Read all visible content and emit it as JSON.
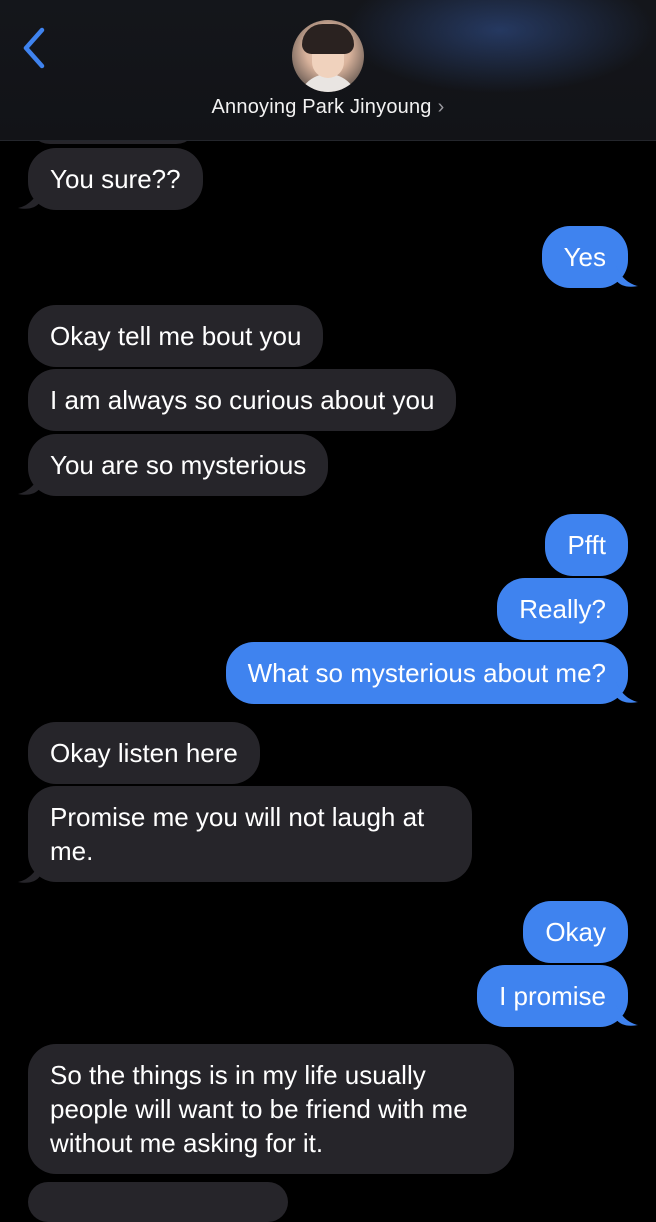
{
  "header": {
    "back_icon": "chevron-left-icon",
    "contact_name": "Annoying Park Jinyoung",
    "chevron_icon": "chevron-right-icon",
    "accent_color": "#3f83ef"
  },
  "messages": [
    {
      "direction": "incoming",
      "text": "You sure??"
    },
    {
      "direction": "outgoing",
      "text": "Yes"
    },
    {
      "direction": "incoming",
      "text": "Okay tell me bout you"
    },
    {
      "direction": "incoming",
      "text": "I am always so curious about you"
    },
    {
      "direction": "incoming",
      "text": "You are so mysterious"
    },
    {
      "direction": "outgoing",
      "text": "Pfft"
    },
    {
      "direction": "outgoing",
      "text": "Really?"
    },
    {
      "direction": "outgoing",
      "text": "What so mysterious about me?"
    },
    {
      "direction": "incoming",
      "text": "Okay listen here"
    },
    {
      "direction": "incoming",
      "text": "Promise me you will not laugh at me."
    },
    {
      "direction": "outgoing",
      "text": "Okay"
    },
    {
      "direction": "outgoing",
      "text": "I promise"
    },
    {
      "direction": "incoming",
      "text": "So the things is in my life usually people will want to be friend with me without me asking for it."
    }
  ]
}
